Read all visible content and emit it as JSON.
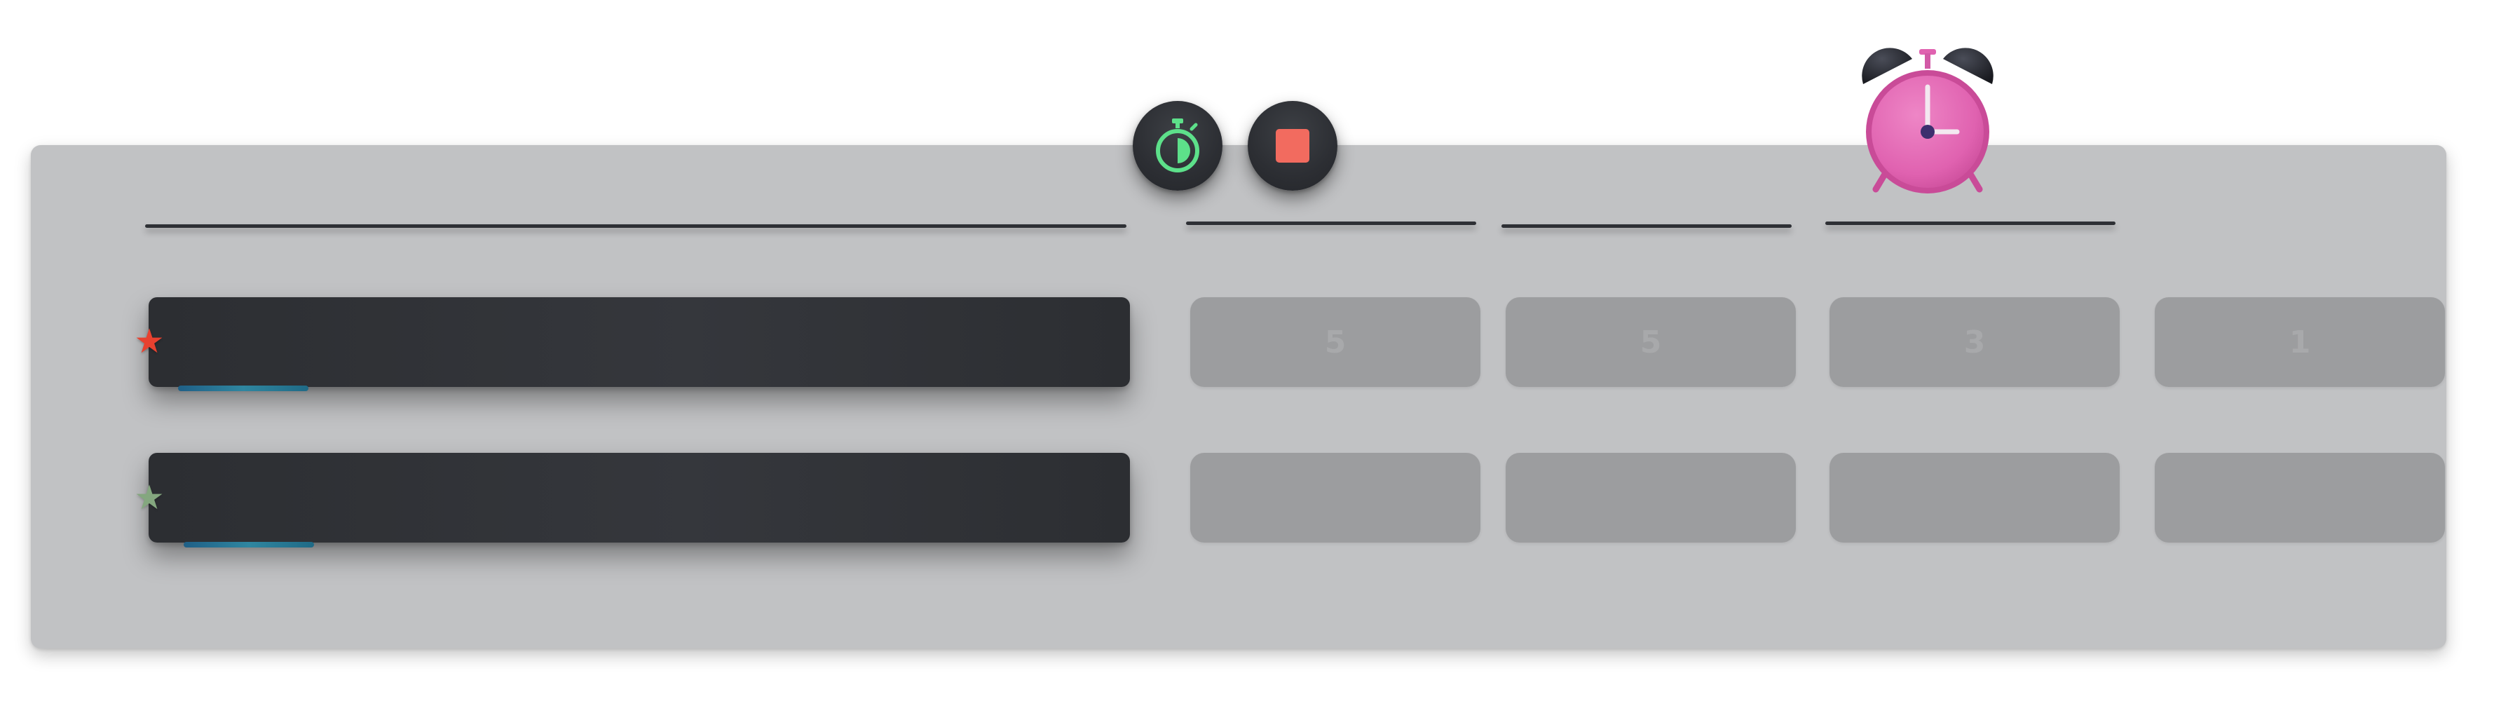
{
  "board": {
    "rows": [
      {
        "star_color": "red",
        "star_icon": "star-icon",
        "values": [
          "5",
          "5",
          "3",
          "1"
        ]
      },
      {
        "star_color": "green",
        "star_icon": "star-icon",
        "values": [
          "",
          "",
          "",
          ""
        ]
      }
    ]
  },
  "controls": {
    "timer_icon": "stopwatch-icon",
    "stop_icon": "stop-icon",
    "alarm_icon": "alarm-clock-icon"
  },
  "colors": {
    "panel": "#c1c2c4",
    "task_bar": "#2f3136",
    "cell": "#9c9d9f",
    "star_red": "#e8412f",
    "star_green": "#84a77f",
    "timer_green": "#5de08a",
    "stop_red": "#f26b5f",
    "alarm_pink": "#e466b0",
    "progress": "#2f86a0"
  }
}
